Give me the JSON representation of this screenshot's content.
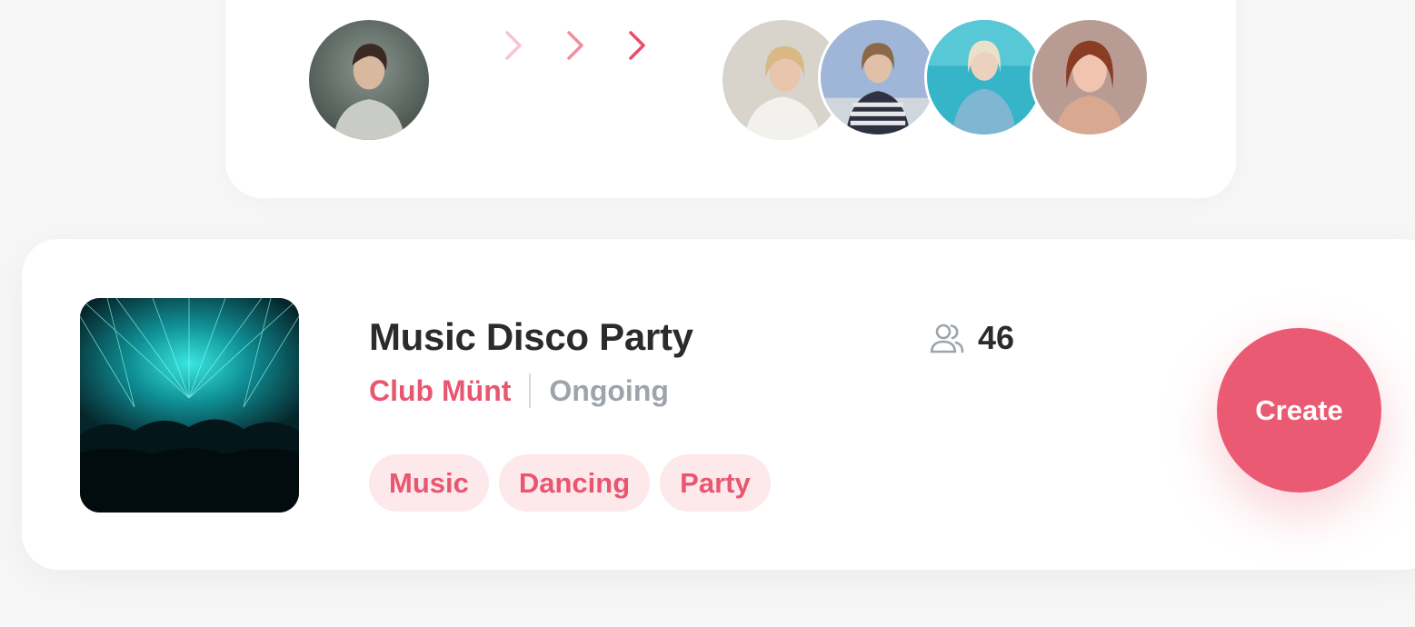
{
  "transfer": {
    "from_avatar": "man-profile-photo",
    "to_avatars": [
      "woman-avatar-1",
      "woman-avatar-2",
      "woman-avatar-3",
      "woman-avatar-4"
    ],
    "arrow_icon": "chevron-right-icon"
  },
  "event": {
    "title": "Music Disco Party",
    "venue": "Club Münt",
    "status": "Ongoing",
    "tags": [
      "Music",
      "Dancing",
      "Party"
    ],
    "attendee_icon": "people-icon",
    "attendee_count": "46",
    "thumbnail": "laser-concert-image"
  },
  "actions": {
    "create_label": "Create"
  },
  "colors": {
    "accent": "#ea5a72",
    "tag_bg": "#fde8ec",
    "title": "#2b2b2e",
    "muted": "#9ea4ac"
  }
}
